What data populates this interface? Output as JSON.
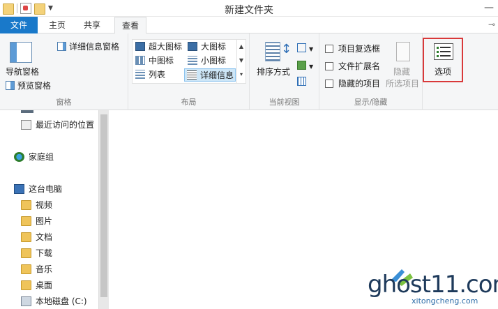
{
  "window": {
    "title": "新建文件夹"
  },
  "tabs": [
    {
      "label": "文件"
    },
    {
      "label": "主页"
    },
    {
      "label": "共享"
    },
    {
      "label": "查看"
    }
  ],
  "ribbon": {
    "panes": {
      "navigation_pane": "导航窗格",
      "preview_pane": "预览窗格",
      "details_pane": "详细信息窗格",
      "group_label": "窗格"
    },
    "layout": {
      "items": [
        "超大图标",
        "大图标",
        "中图标",
        "小图标",
        "列表",
        "详细信息"
      ],
      "selected": "详细信息",
      "group_label": "布局"
    },
    "current_view": {
      "sort_by": "排序方式",
      "group_label": "当前视图"
    },
    "show_hide": {
      "item_checkboxes": "项目复选框",
      "file_extensions": "文件扩展名",
      "hidden_items": "隐藏的项目",
      "hide_selected_line1": "隐藏",
      "hide_selected_line2": "所选项目",
      "group_label": "显示/隐藏"
    },
    "options": {
      "label": "选项"
    }
  },
  "navigation": {
    "items": [
      {
        "label": "最近访问的位置"
      },
      {
        "label": "家庭组"
      },
      {
        "label": "这台电脑"
      },
      {
        "label": "视频"
      },
      {
        "label": "图片"
      },
      {
        "label": "文档"
      },
      {
        "label": "下载"
      },
      {
        "label": "音乐"
      },
      {
        "label": "桌面"
      },
      {
        "label": "本地磁盘 (C:)"
      }
    ]
  },
  "watermark": {
    "main": "ghost11.com",
    "sub": "xitongcheng.com"
  },
  "colors": {
    "file_tab": "#1979ca",
    "highlight_box": "#d9393a",
    "ribbon_bg": "#f5f6f7"
  }
}
